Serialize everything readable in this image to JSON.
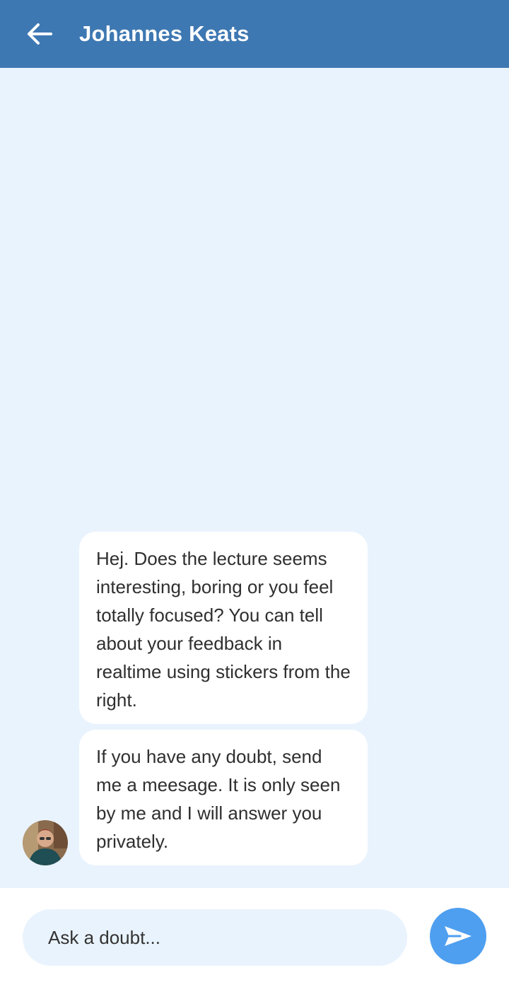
{
  "header": {
    "title": "Johannes Keats",
    "back_icon": "arrow-left-icon"
  },
  "messages": [
    {
      "sender": "Johannes Keats",
      "text": "Hej. Does the lecture seems interesting, boring or you feel totally focused? You can tell about your feedback in realtime using stickers from the right."
    },
    {
      "sender": "Johannes Keats",
      "text": "If you have any doubt, send me a meesage. It is only seen by me and I will answer you privately."
    }
  ],
  "composer": {
    "placeholder": "Ask a doubt...",
    "value": "",
    "send_icon": "send-icon"
  },
  "colors": {
    "header_bg": "#3e78b2",
    "chat_bg": "#e9f3fd",
    "bubble_bg": "#ffffff",
    "send_button": "#4e9ff0"
  }
}
